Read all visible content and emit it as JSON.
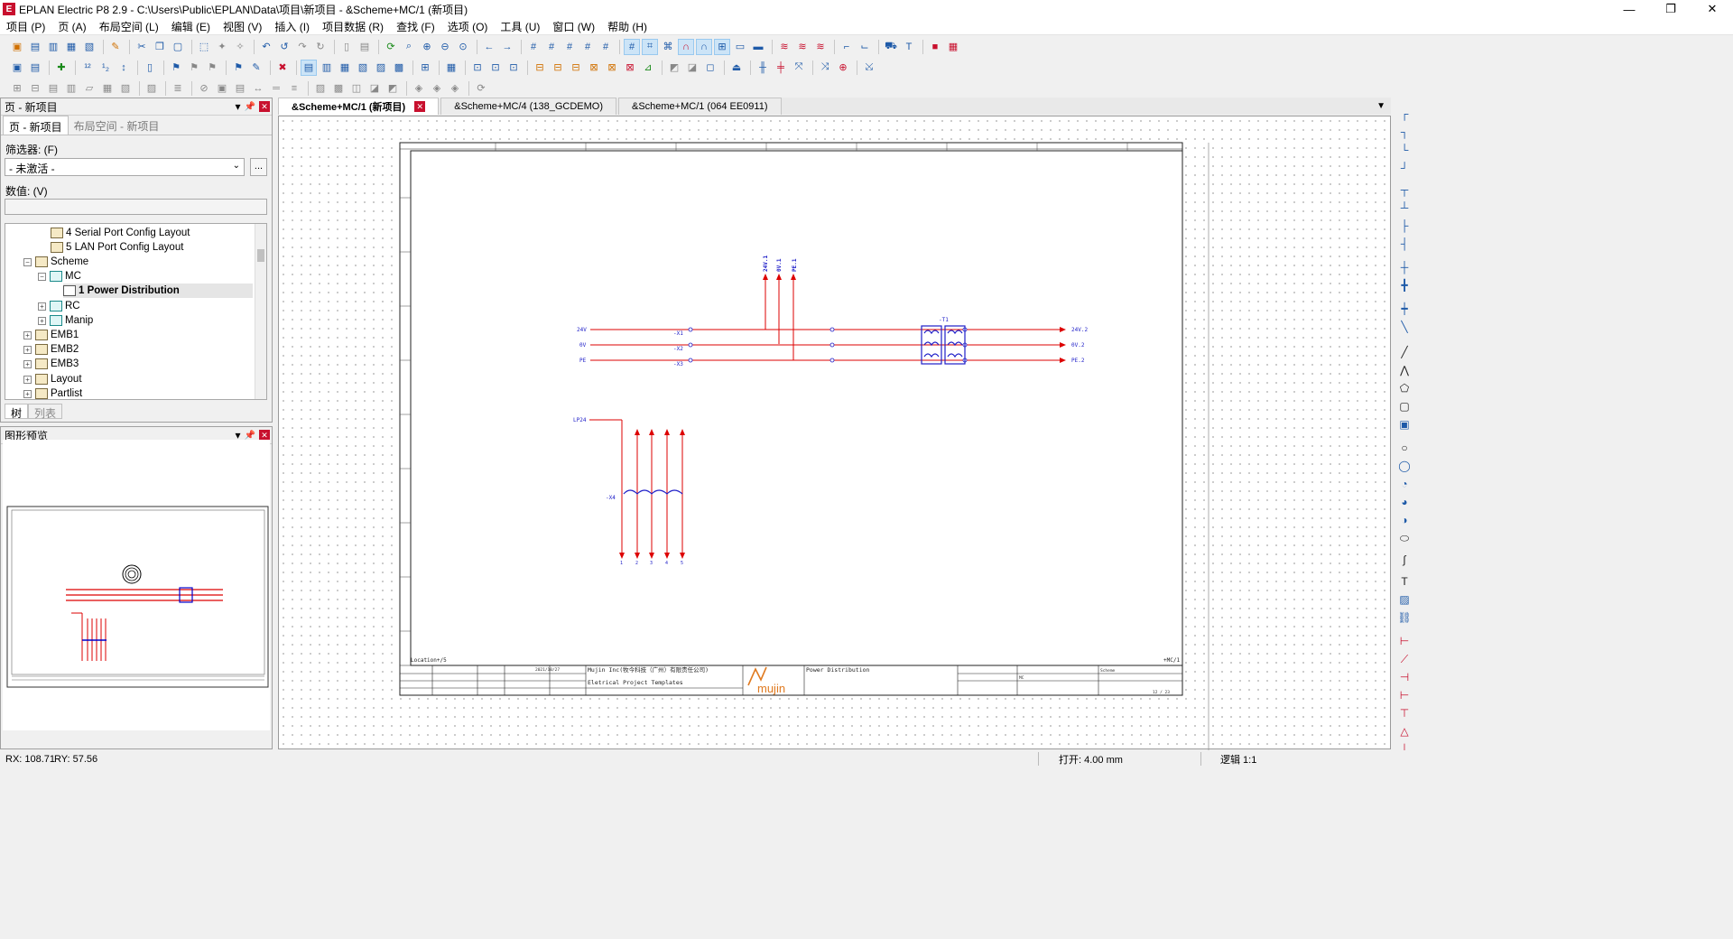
{
  "window": {
    "title": "EPLAN Electric P8 2.9 - C:\\Users\\Public\\EPLAN\\Data\\项目\\新项目 - &Scheme+MC/1 (新项目)",
    "min": "—",
    "max": "❐",
    "close": "✕"
  },
  "menu": [
    "项目 (P)",
    "页 (A)",
    "布局空间 (L)",
    "编辑 (E)",
    "视图 (V)",
    "插入 (I)",
    "项目数据 (R)",
    "查找 (F)",
    "选项 (O)",
    "工具 (U)",
    "窗口 (W)",
    "帮助 (H)"
  ],
  "page_panel": {
    "title": "页 - 新项目",
    "tabs": [
      "页 - 新项目",
      "布局空间 - 新项目"
    ],
    "filter_label": "筛选器: (F)",
    "filter_value": "- 未激活 -",
    "browse": "...",
    "value_label": "数值: (V)",
    "tree": [
      {
        "label": "4 Serial Port Config Layout"
      },
      {
        "label": "5 LAN Port Config Layout"
      },
      {
        "label": "Scheme",
        "exp": "−"
      },
      {
        "label": "MC",
        "exp": "−"
      },
      {
        "label": "1 Power Distribution"
      },
      {
        "label": "RC",
        "exp": "+"
      },
      {
        "label": "Manip",
        "exp": "+"
      },
      {
        "label": "EMB1",
        "exp": "+"
      },
      {
        "label": "EMB2",
        "exp": "+"
      },
      {
        "label": "EMB3",
        "exp": "+"
      },
      {
        "label": "Layout",
        "exp": "+"
      },
      {
        "label": "Partlist",
        "exp": "+"
      }
    ],
    "bottom_tabs": [
      "树",
      "列表"
    ]
  },
  "preview_panel": {
    "title": "图形预览"
  },
  "doc_tabs": [
    "&Scheme+MC/1 (新项目)",
    "&Scheme+MC/4 (138_GCDEMO)",
    "&Scheme+MC/1 (064 EE0911)"
  ],
  "schematic": {
    "frame_top_left": "",
    "terminal_labels": [
      "24V.1",
      "0V.1",
      "PE.1"
    ],
    "bus_left": [
      "24V",
      "0V",
      "PE"
    ],
    "terminals": [
      "-X1",
      "-X2",
      "-X3"
    ],
    "transformer": "-T1",
    "bus_right": [
      "24V.2",
      "0V.2",
      "PE.2"
    ],
    "lower_source": "LP24",
    "lower_comp": "-X4",
    "lower_outputs": [
      "1",
      "2",
      "3",
      "4",
      "5"
    ],
    "location": "Location+/5",
    "page_ref": "+MC/1",
    "company": "Mujin Inc(牧今科技（广州）有限责任公司)",
    "template": "Eletrical Project Templates",
    "page_title": "Power Distribution",
    "date": "2021/10/27",
    "logo": "mujin",
    "scheme": "Scheme",
    "mc": "MC",
    "page_no": "12 / 23"
  },
  "status": {
    "rx": "RX: 108.71",
    "ry": "RY: 57.56",
    "grid": "打开: 4.00 mm",
    "logic": "逻辑 1:1"
  }
}
